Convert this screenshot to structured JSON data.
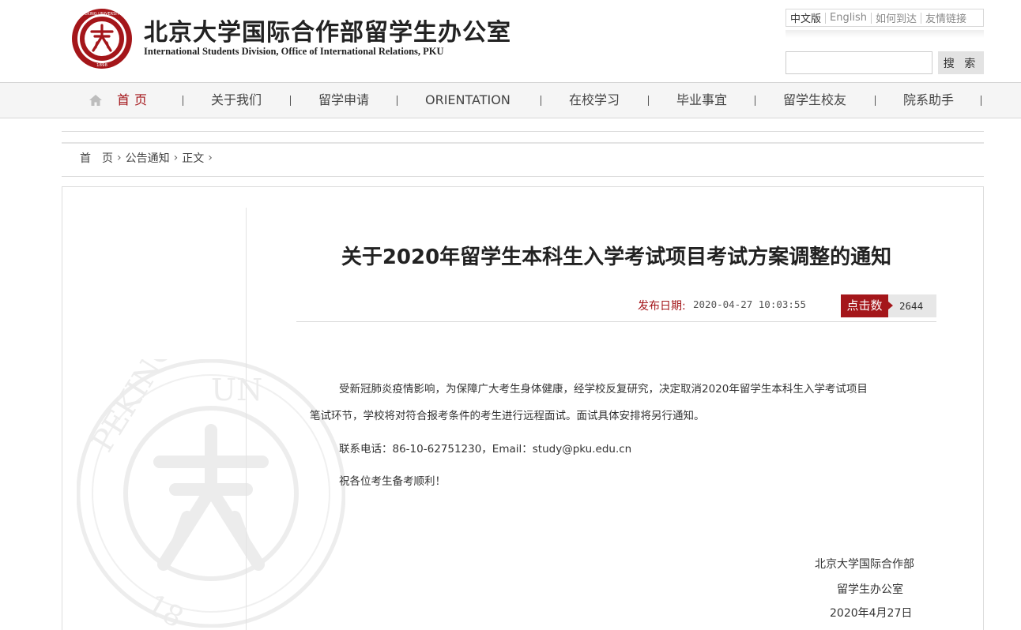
{
  "header": {
    "title_cn": "北京大学国际合作部留学生办公室",
    "title_en": "International Students Division, Office of International Relations, PKU",
    "seal": {
      "arc_text": "PEKING UNIVERSITY",
      "year": "1898",
      "color": "#a4161a"
    },
    "top_links": [
      {
        "label": "中文版"
      },
      {
        "label": "English"
      },
      {
        "label": "如何到达"
      },
      {
        "label": "友情链接"
      }
    ],
    "search": {
      "value": "",
      "placeholder": "",
      "button_label": "搜 索"
    }
  },
  "nav": {
    "home_icon": "house-icon",
    "items": [
      {
        "label": "首页"
      },
      {
        "label": "关于我们"
      },
      {
        "label": "留学申请"
      },
      {
        "label": "ORIENTATION"
      },
      {
        "label": "在校学习"
      },
      {
        "label": "毕业事宜"
      },
      {
        "label": "留学生校友"
      },
      {
        "label": "院系助手"
      }
    ]
  },
  "breadcrumb": {
    "items": [
      {
        "label": "首　页"
      },
      {
        "label": "公告通知"
      },
      {
        "label": "正文"
      }
    ],
    "separator": "›"
  },
  "article": {
    "title": "关于2020年留学生本科生入学考试项目考试方案调整的通知",
    "date_label": "发布日期:",
    "date_value": "2020-04-27 10:03:55",
    "hits_label": "点击数",
    "hits_value": "2644",
    "paragraphs": [
      "受新冠肺炎疫情影响，为保障广大考生身体健康，经学校反复研究，决定取消2020年留学生本科生入学考试项目",
      "笔试环节，学校将对符合报考条件的考生进行远程面试。面试具体安排将另行通知。",
      "联系电话：86-10-62751230，Email：study@pku.edu.cn",
      "祝各位考生备考顺利！"
    ],
    "signature": [
      "北京大学国际合作部",
      "留学生办公室",
      "2020年4月27日"
    ]
  },
  "theme": {
    "accent": "#a4161a",
    "nav_bg": "#f5f5f5",
    "border": "#dcdcdc"
  }
}
